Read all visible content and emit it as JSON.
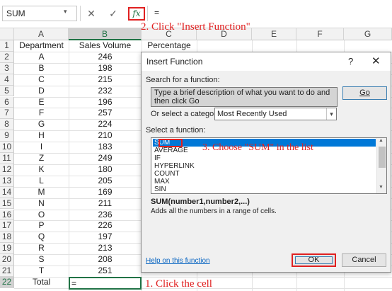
{
  "formula_bar": {
    "name_box": "SUM",
    "name_box_arrow": "▾",
    "cancel_icon": "✕",
    "enter_icon": "✓",
    "fx_label": "fx",
    "formula": "="
  },
  "columns": [
    "A",
    "B",
    "C",
    "D",
    "E",
    "F",
    "G"
  ],
  "rows": [
    "1",
    "2",
    "3",
    "4",
    "5",
    "6",
    "7",
    "8",
    "9",
    "10",
    "11",
    "12",
    "13",
    "14",
    "15",
    "16",
    "17",
    "18",
    "19",
    "20",
    "21",
    "22"
  ],
  "table": {
    "headers": [
      "Department",
      "Sales Volume",
      "Percentage"
    ],
    "departments": [
      "A",
      "B",
      "C",
      "D",
      "E",
      "F",
      "G",
      "H",
      "I",
      "Z",
      "K",
      "L",
      "M",
      "N",
      "O",
      "P",
      "Q",
      "R",
      "S",
      "T"
    ],
    "sales": [
      "246",
      "198",
      "215",
      "232",
      "196",
      "257",
      "224",
      "210",
      "183",
      "249",
      "180",
      "205",
      "169",
      "211",
      "236",
      "226",
      "197",
      "213",
      "208",
      "251"
    ],
    "total_label": "Total",
    "active_value": "="
  },
  "annotations": {
    "step1": "1. Click the cell",
    "step2": "2. Click \"Insert Function\"",
    "step3": "3. Choose \"SUM\" in the list"
  },
  "dialog": {
    "title": "Insert Function",
    "help": "?",
    "close": "✕",
    "search_label": "Search for a function:",
    "search_text": "Type a brief description of what you want to do and then click Go",
    "go": "Go",
    "category_label": "Or select a category:",
    "category_value": "Most Recently Used",
    "select_label": "Select a function:",
    "functions": [
      "SUM",
      "AVERAGE",
      "IF",
      "HYPERLINK",
      "COUNT",
      "MAX",
      "SIN"
    ],
    "selected_function": "SUM",
    "signature": "SUM(number1,number2,...)",
    "description": "Adds all the numbers in a range of cells.",
    "help_link": "Help on this function",
    "ok": "OK",
    "cancel": "Cancel"
  },
  "colors": {
    "annotation_red": "#e02020",
    "excel_green": "#217346",
    "selection_blue": "#0078d7"
  }
}
